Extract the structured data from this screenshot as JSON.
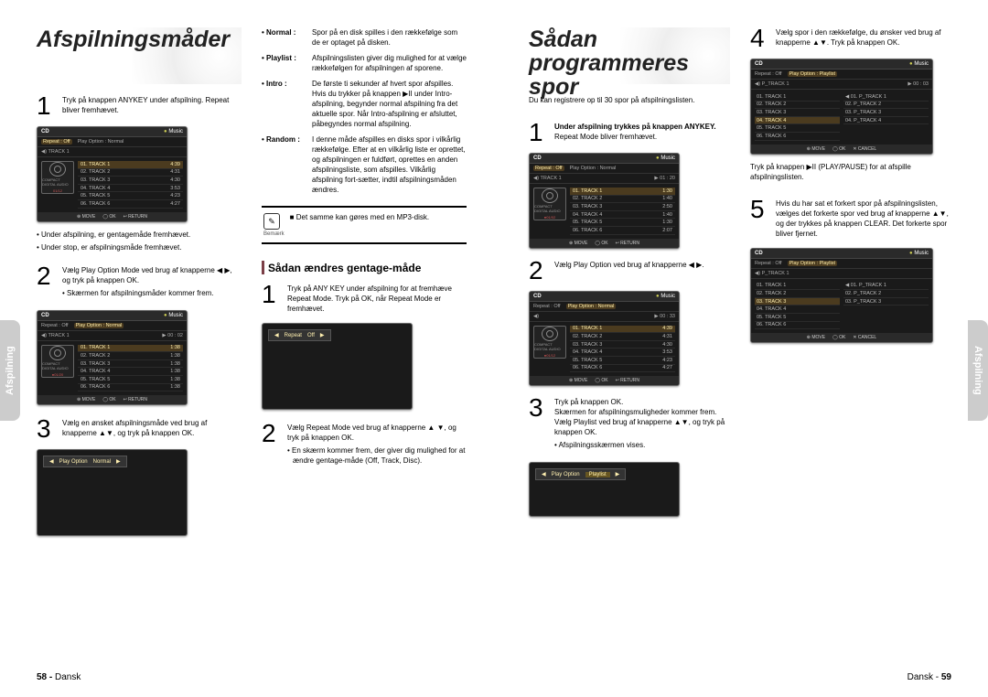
{
  "leftPage": {
    "sidetab": "Afspilning",
    "title": "Afspilningsmåder",
    "col1": {
      "step1": "Tryk på knappen ANYKEY under afspilning. Repeat bliver fremhævet.",
      "bullet1": "Under afspilning, er gentagemåde fremhævet.",
      "bullet2": "Under stop, er afspilningsmåde fremhævet.",
      "step2": "Vælg Play Option Mode ved brug af knapperne ◀ ▶, og tryk på knappen OK.",
      "step2b": "Skærmen for afspilningsmåder kommer frem.",
      "step3": "Vælg en ønsket afspilningsmåde ved brug af knapperne ▲▼, og tryk på knappen OK."
    },
    "col2": {
      "def": [
        {
          "term": "• Normal :",
          "desc": "Spor på en disk spilles i den rækkefølge som de er optaget på disken."
        },
        {
          "term": "• Playlist :",
          "desc": "Afspilningslisten giver dig mulighed for at vælge rækkefølgen for afspilningen af sporene."
        },
        {
          "term": "• Intro :",
          "desc": "De første ti sekunder af hvert spor afspilles. Hvis du trykker på knappen ▶II under Intro-afspilning, begynder normal afspilning fra det aktuelle spor. Når Intro-afspilning er afsluttet, påbegyndes normal afspilning."
        },
        {
          "term": "• Random :",
          "desc": "I denne måde afspilles en disks spor i vilkårlig rækkefølge. Efter at en vilkårlig liste er oprettet, og afspilningen er fuldført, oprettes en anden afspilningsliste, som afspilles. Vilkårlig afspilning fort-sætter, indtil afspilningsmåden ændres."
        }
      ],
      "note": "Det samme kan gøres med en MP3-disk.",
      "noteCaption": "Bemærk",
      "subTitle": "Sådan ændres gentage-måde",
      "r_step1": "Tryk på ANY KEY under afspilning for at fremhæve Repeat Mode. Tryk på OK, når Repeat Mode er fremhævet.",
      "r_step2": "Vælg Repeat Mode ved brug af knapperne ▲ ▼, og tryk på knappen OK.",
      "r_step2b": "En skærm kommer frem, der giver dig mulighed for at ændre gentage-måde (Off, Track, Disc)."
    },
    "footer": "58 - Dansk"
  },
  "rightPage": {
    "sidetab": "Afspilning",
    "title": "Sådan programmeres spor",
    "intro": "Du kan registrere op til 30 spor på afspilningslisten.",
    "col1": {
      "step1a": "Under afspilning trykkes på knappen ANYKEY.",
      "step1b": "Repeat Mode bliver fremhævet.",
      "step2": "Vælg Play Option ved brug af knapperne ◀ ▶.",
      "step3a": "Tryk på knappen OK.",
      "step3b": "Skærmen for afspilningsmuligheder kommer frem. Vælg Playlist ved brug af knapperne ▲▼, og tryk på knappen OK.",
      "step3c": "Afspilningsskærmen vises."
    },
    "col2": {
      "step4": "Vælg spor i den rækkefølge, du ønsker ved brug af knapperne ▲▼. Tryk på knappen OK.",
      "step4b": "Tryk på knappen ▶II (PLAY/PAUSE) for at afspille afspilningslisten.",
      "step5": "Hvis du har sat et forkert spor på afspilningslisten, vælges det forkerte spor ved brug af knapperne ▲▼, og der trykkes på knappen CLEAR. Det forkerte spor bliver fjernet."
    },
    "footer": "Dansk - 59"
  },
  "screens": {
    "hdr_cd": "CD",
    "hdr_music": "Music",
    "bar2_repeat": "Repeat : Off",
    "bar2_play_normal": "Play Option : Normal",
    "bar2_play_playlist": "Play Option : Playlist",
    "bar2_ptrack": "P_TRACK 1",
    "bar2_time1": "00 : 02",
    "bar2_time2": "00 : 33",
    "bar2_time3": "01 : 20",
    "bar2_time4": "00 : 03",
    "cd_label": "COMPACT DIGITAL AUDIO",
    "cd_count": "01/12",
    "tracks_a": [
      {
        "n": "01. TRACK 1",
        "t": "4:39"
      },
      {
        "n": "02. TRACK 2",
        "t": "4:31"
      },
      {
        "n": "03. TRACK 3",
        "t": "4:30"
      },
      {
        "n": "04. TRACK 4",
        "t": "3:53"
      },
      {
        "n": "05. TRACK 5",
        "t": "4:23"
      },
      {
        "n": "06. TRACK 6",
        "t": "4:27"
      }
    ],
    "tracks_b": [
      {
        "n": "01. TRACK 1",
        "t": "1:38"
      },
      {
        "n": "02. TRACK 2",
        "t": "1:38"
      },
      {
        "n": "03. TRACK 3",
        "t": "1:38"
      },
      {
        "n": "04. TRACK 4",
        "t": "1:38"
      },
      {
        "n": "05. TRACK 5",
        "t": "1:38"
      },
      {
        "n": "06. TRACK 6",
        "t": "1:38"
      }
    ],
    "tracks_c": [
      {
        "n": "01. TRACK 1",
        "t": "1:30"
      },
      {
        "n": "02. TRACK 2",
        "t": "1:40"
      },
      {
        "n": "03. TRACK 3",
        "t": "2:50"
      },
      {
        "n": "04. TRACK 4",
        "t": "1:40"
      },
      {
        "n": "05. TRACK 5",
        "t": "1:30"
      },
      {
        "n": "06. TRACK 6",
        "t": "2:07"
      }
    ],
    "tracks_d": [
      {
        "n": "01. TRACK 1",
        "t": "4:39"
      },
      {
        "n": "02. TRACK 2",
        "t": "4:31"
      },
      {
        "n": "03. TRACK 3",
        "t": "4:30"
      },
      {
        "n": "04. TRACK 4",
        "t": "3:53"
      },
      {
        "n": "05. TRACK 5",
        "t": "4:23"
      },
      {
        "n": "06. TRACK 6",
        "t": "4:27"
      }
    ],
    "playlist_left": [
      "01. TRACK 1",
      "02. TRACK 2",
      "03. TRACK 3",
      "04. TRACK 4",
      "05. TRACK 5",
      "06. TRACK 6"
    ],
    "playlist_right_4": [
      "01. P_TRACK 1",
      "02. P_TRACK 2",
      "03. P_TRACK 3",
      "04. P_TRACK 4"
    ],
    "playlist_right_3": [
      "01. P_TRACK 1",
      "02. P_TRACK 2",
      "03. P_TRACK 3"
    ],
    "footer_move": "MOVE",
    "footer_ok": "OK",
    "footer_return": "RETURN",
    "footer_cancel": "CANCEL",
    "opt_repeat": "Repeat",
    "opt_off": "Off",
    "opt_play": "Play Option",
    "opt_normal": "Normal",
    "opt_playlist": "Playlist"
  }
}
